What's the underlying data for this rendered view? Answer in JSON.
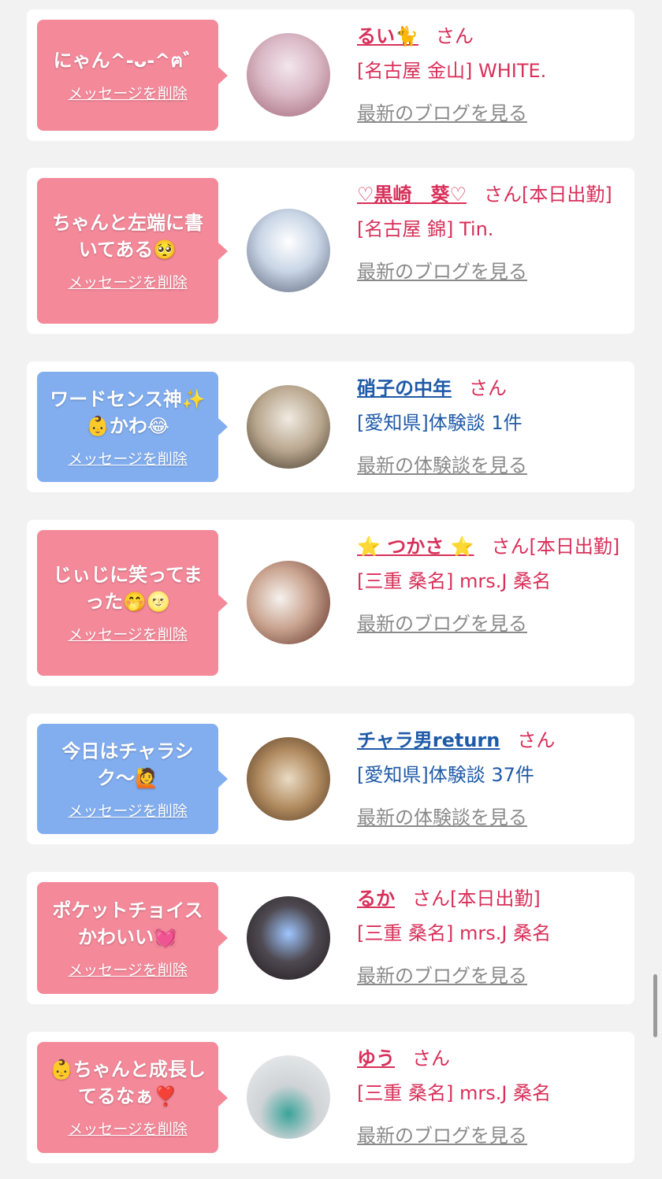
{
  "delete_label": "メッセージを削除",
  "colors": {
    "pink_bubble": "#f4899a",
    "blue_bubble": "#82aef0",
    "pink_text": "#d8305a",
    "blue_text": "#1f5aa8",
    "link_gray": "#8a8a8a"
  },
  "items": [
    {
      "message": "にゃん^-ᴗ-^ฅ゛",
      "bubble": "pink",
      "name": "るい🐈",
      "honor": "さん",
      "shop": "[名古屋 金山] WHITE.",
      "link": "最新のブログを見る"
    },
    {
      "message": "ちゃんと左端に書いてある🥺",
      "bubble": "pink",
      "name": "♡黒崎　葵♡",
      "honor": "さん[本日出勤]",
      "shop": "[名古屋 錦] Tin.",
      "link": "最新のブログを見る"
    },
    {
      "message": "ワードセンス神✨👶かわ😂",
      "bubble": "blue",
      "name": "硝子の中年",
      "honor": "さん",
      "shop": "[愛知県]体験談 1件",
      "link": "最新の体験談を見る"
    },
    {
      "message": "じぃじに笑ってまった🤭🌝",
      "bubble": "pink",
      "name": "⭐ つかさ ⭐",
      "honor": "さん[本日出勤]",
      "shop": "[三重 桑名] mrs.J 桑名",
      "link": "最新のブログを見る"
    },
    {
      "message": "今日はチャラシク〜🙋",
      "bubble": "blue",
      "name": "チャラ男return",
      "honor": "さん",
      "shop": "[愛知県]体験談 37件",
      "link": "最新の体験談を見る"
    },
    {
      "message": "ポケットチョイスかわいい💓",
      "bubble": "pink",
      "name": "るか",
      "honor": "さん[本日出勤]",
      "shop": "[三重 桑名] mrs.J 桑名",
      "link": "最新のブログを見る"
    },
    {
      "message": "👶ちゃんと成長してるなぁ❣️",
      "bubble": "pink",
      "name": "ゆう",
      "honor": "さん",
      "shop": "[三重 桑名] mrs.J 桑名",
      "link": "最新のブログを見る"
    }
  ]
}
